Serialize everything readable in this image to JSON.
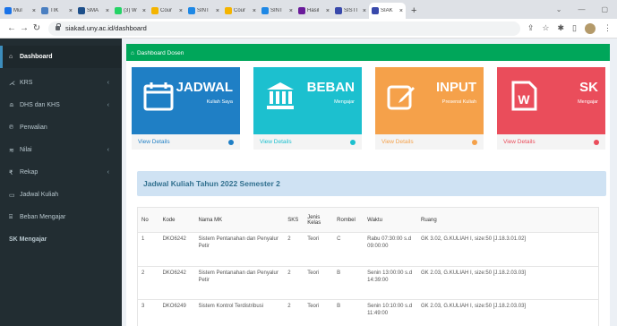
{
  "browser": {
    "tabs": [
      {
        "label": "Mul",
        "color": "#1a73e8"
      },
      {
        "label": "TIK",
        "color": "#4a7fc1"
      },
      {
        "label": "SMA",
        "color": "#1d4f8a"
      },
      {
        "label": "(3) W",
        "color": "#25d366"
      },
      {
        "label": "Cour",
        "color": "#f4b400"
      },
      {
        "label": "SINT",
        "color": "#1e88e5"
      },
      {
        "label": "Cour",
        "color": "#f4b400"
      },
      {
        "label": "SINT",
        "color": "#1e88e5"
      },
      {
        "label": "Hasil",
        "color": "#6a1b9a"
      },
      {
        "label": "SISTI",
        "color": "#3949ab"
      },
      {
        "label": "SIAK",
        "color": "#3949ab"
      }
    ],
    "url": "siakad.uny.ac.id/dashboard"
  },
  "sidebar": {
    "items": [
      {
        "label": "Dashboard",
        "icon": "home-icon",
        "glyph": "⌂",
        "chev": ""
      },
      {
        "label": "KRS",
        "icon": "fork-icon",
        "glyph": "⋌",
        "chev": "‹"
      },
      {
        "label": "DHS dan KHS",
        "icon": "graduation-icon",
        "glyph": "≘",
        "chev": "‹"
      },
      {
        "label": "Perwalian",
        "icon": "parking-icon",
        "glyph": "℗",
        "chev": ""
      },
      {
        "label": "Nilai",
        "icon": "grades-icon",
        "glyph": "≋",
        "chev": "‹"
      },
      {
        "label": "Rekap",
        "icon": "rupee-icon",
        "glyph": "₹",
        "chev": "‹"
      },
      {
        "label": "Jadwal Kuliah",
        "icon": "calendar-icon",
        "glyph": "▭",
        "chev": ""
      },
      {
        "label": "Beban Mengajar",
        "icon": "bank-icon",
        "glyph": "⌸",
        "chev": ""
      },
      {
        "label": "SK Mengajar",
        "icon": "",
        "glyph": "",
        "chev": ""
      }
    ]
  },
  "header": {
    "title": "Dashboard Dosen"
  },
  "tiles": [
    {
      "big": "JADWAL",
      "sub": "Kuliah Saya",
      "link": "View Details",
      "color": "#1f7fc5",
      "icon": "calendar-icon"
    },
    {
      "big": "BEBAN",
      "sub": "Mengajar",
      "link": "View Details",
      "color": "#1cc0cf",
      "icon": "bank-icon"
    },
    {
      "big": "INPUT",
      "sub": "Presensi Kuliah",
      "link": "View Details",
      "color": "#f5a14a",
      "icon": "edit-icon"
    },
    {
      "big": "SK",
      "sub": "Mengajar",
      "link": "View Details",
      "color": "#ea4d5b",
      "icon": "word-doc-icon"
    }
  ],
  "schedule": {
    "title": "Jadwal Kuliah Tahun 2022 Semester 2",
    "columns": [
      "No",
      "Kode",
      "Nama MK",
      "SKS",
      "Jenis Kelas",
      "Rombel",
      "Waktu",
      "Ruang"
    ],
    "rows": [
      [
        "1",
        "DKO6242",
        "Sistem Pentanahan dan Penyalur Petir",
        "2",
        "Teori",
        "C",
        "Rabu 07:30:00 s.d 09:00:00",
        "GK 3.02, G.KULIAH I, size:50 [J.18.3.01.02]"
      ],
      [
        "2",
        "DKO6242",
        "Sistem Pentanahan dan Penyalur Petir",
        "2",
        "Teori",
        "B",
        "Senin 13:00:00 s.d 14:39:00",
        "GK 2.03, G.KULIAH I, size:50 [J.18.2.03.03]"
      ],
      [
        "3",
        "DKO6249",
        "Sistem Kontrol Terdistribusi",
        "2",
        "Teori",
        "B",
        "Senin 10:10:00 s.d 11:49:00",
        "GK 2.03, G.KULIAH I, size:50 [J.18.2.03.03]"
      ]
    ]
  }
}
